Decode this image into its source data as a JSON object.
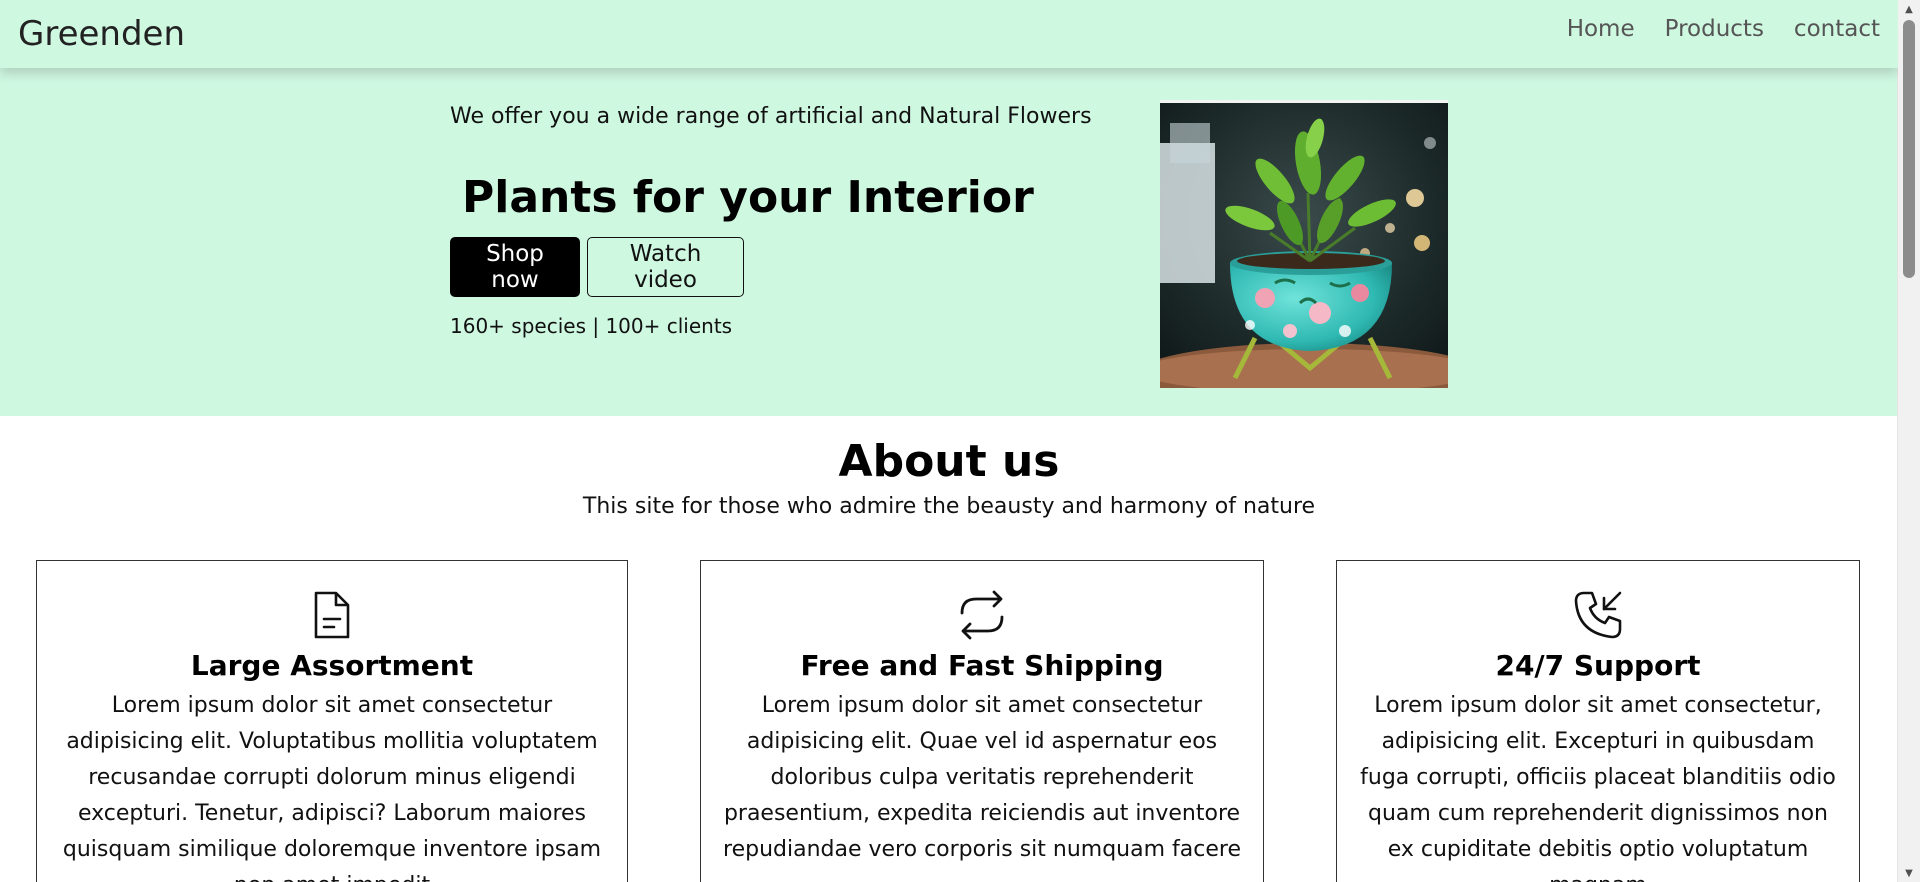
{
  "navbar": {
    "brand": "Greenden",
    "links": [
      "Home",
      "Products",
      "contact"
    ]
  },
  "hero": {
    "tagline": "We offer you a wide range of artificial and Natural Flowers",
    "title": "Plants for your Interior",
    "primary_button": "Shop now",
    "secondary_button": "Watch video",
    "stats": "160+ species | 100+ clients",
    "image_alt": "potted-plant-photo"
  },
  "about": {
    "title": "About us",
    "subtitle": "This site for those who admire the beausty and harmony of nature",
    "cards": [
      {
        "icon": "document-icon",
        "title": "Large Assortment",
        "text": "Lorem ipsum dolor sit amet consectetur adipisicing elit. Voluptatibus mollitia voluptatem recusandae corrupti dolorum minus eligendi excepturi. Tenetur, adipisci? Laborum maiores quisquam similique doloremque inventore ipsam non amet impedit"
      },
      {
        "icon": "refresh-icon",
        "title": "Free and Fast Shipping",
        "text": "Lorem ipsum dolor sit amet consectetur adipisicing elit. Quae vel id aspernatur eos doloribus culpa veritatis reprehenderit praesentium, expedita reiciendis aut inventore repudiandae vero corporis sit numquam facere"
      },
      {
        "icon": "phone-incoming-icon",
        "title": "24/7 Support",
        "text": "Lorem ipsum dolor sit amet consectetur, adipisicing elit. Excepturi in quibusdam fuga corrupti, officiis placeat blanditiis odio quam cum reprehenderit dignissimos non ex cupiditate debitis optio voluptatum magnam"
      }
    ]
  },
  "colors": {
    "mint_background": "#cff8e1",
    "button_dark": "#000000",
    "pot_turquoise": "#39c9c2"
  }
}
